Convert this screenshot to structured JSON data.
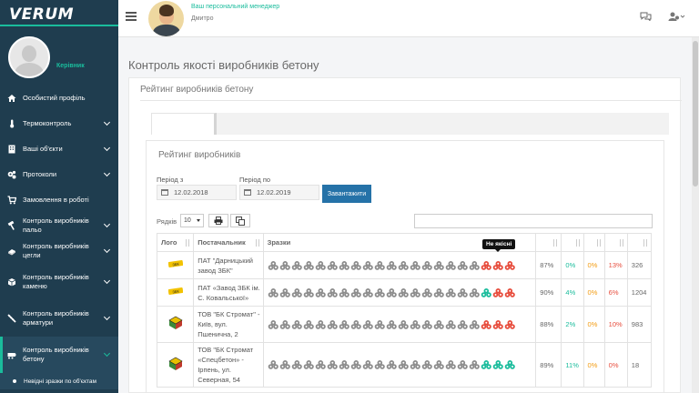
{
  "brand": {
    "logo": "VERUM"
  },
  "profile": {
    "role": "Керівник"
  },
  "sidebar": {
    "items": [
      {
        "label": "Особистий профіль",
        "icon": "home-icon"
      },
      {
        "label": "Термоконтроль",
        "icon": "thermometer-icon"
      },
      {
        "label": "Ваші об'єкти",
        "icon": "building-icon"
      },
      {
        "label": "Протоколи",
        "icon": "cogs-icon"
      },
      {
        "label": "Замовлення в роботі",
        "icon": "cart-icon"
      },
      {
        "label": "Контроль виробників пальо",
        "icon": "hammer-icon"
      },
      {
        "label": "Контроль виробників цегли",
        "icon": "brick-icon"
      },
      {
        "label": "Контроль виробників каменю",
        "icon": "stone-icon"
      },
      {
        "label": "Контроль виробників арматури",
        "icon": "rebar-icon"
      },
      {
        "label": "Контроль виробників бетону",
        "icon": "concrete-icon"
      }
    ],
    "submenu": "Невідні зразки по об'єктам"
  },
  "topbar": {
    "manager_title": "Ваш персональний менеджер",
    "manager_name": "Дмитро"
  },
  "page": {
    "title": "Контроль якості виробників бетону",
    "panel_title": "Рейтинг виробників бетону",
    "inner_title": "Рейтинг виробників"
  },
  "filters": {
    "from_label": "Період з",
    "from_value": "12.02.2018",
    "to_label": "Період по",
    "to_value": "12.02.2019",
    "load_button": "Завантажити"
  },
  "table_controls": {
    "rows_label": "Рядків",
    "rows_value": "10"
  },
  "tooltip": "Не якісні",
  "table": {
    "headers": [
      "Лого",
      "Постачальник",
      "Зразки",
      "",
      "",
      "",
      "",
      ""
    ],
    "rows": [
      {
        "supplier": "ПАТ \"Дарницький завод ЗБК\"",
        "good": 18,
        "bad": 3,
        "bad_color": "red",
        "p1": "87%",
        "p2": "0%",
        "p3": "0%",
        "p4": "13%",
        "total": "326"
      },
      {
        "supplier": "ПАТ «Завод ЗБК ім. С. Ковальської»",
        "good": 18,
        "bad": 3,
        "bad_color": "mixed",
        "p1": "90%",
        "p2": "4%",
        "p3": "0%",
        "p4": "6%",
        "total": "1204"
      },
      {
        "supplier": "ТОВ \"БК Стромат\" - Київ, вул. Пшенична, 2",
        "good": 18,
        "bad": 3,
        "bad_color": "red",
        "p1": "88%",
        "p2": "2%",
        "p3": "0%",
        "p4": "10%",
        "total": "983"
      },
      {
        "supplier": "ТОВ \"БК Стромат «Спецбетон» - Ірпень, ул. Северная, 54",
        "good": 18,
        "bad": 3,
        "bad_color": "green",
        "p1": "89%",
        "p2": "11%",
        "p3": "0%",
        "p4": "0%",
        "total": "18"
      }
    ]
  },
  "colors": {
    "sidebar": "#1f3d4f",
    "accent": "#1abc9c",
    "button": "#2572a8",
    "bad": "#e74c3c",
    "sample": "#8c8c8c"
  }
}
